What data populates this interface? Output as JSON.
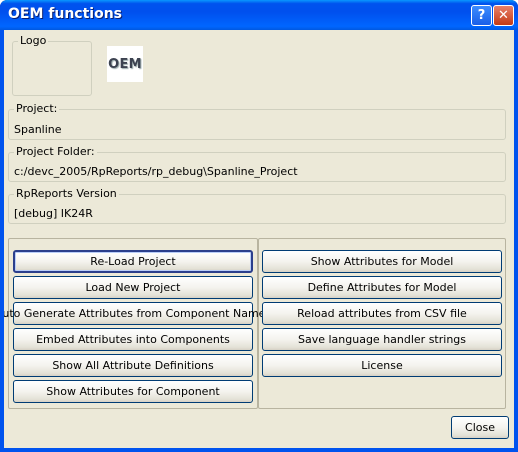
{
  "window": {
    "title": "OEM functions",
    "help_glyph": "?",
    "close_glyph": "✕"
  },
  "logo_group": {
    "legend": "Logo",
    "image_text": "OEM"
  },
  "project": {
    "legend": "Project:",
    "value": "Spanline"
  },
  "project_folder": {
    "legend": "Project Folder:",
    "value": "c:/devc_2005/RpReports/rp_debug\\Spanline_Project"
  },
  "rpreports_version": {
    "legend": "RpReports Version",
    "value": "[debug] IK24R"
  },
  "left_buttons": [
    "Re-Load Project",
    "Load New Project",
    "Auto Generate Attributes from Component Names",
    "Embed Attributes into Components",
    "Show All Attribute Definitions",
    "Show Attributes for Component"
  ],
  "right_buttons": [
    "Show Attributes for Model",
    "Define Attributes for Model",
    "Reload attributes from CSV file",
    "Save language handler strings",
    "License"
  ],
  "close_button": "Close",
  "colors": {
    "title_bar": "#0054e3",
    "dialog_bg": "#ece9d8"
  }
}
